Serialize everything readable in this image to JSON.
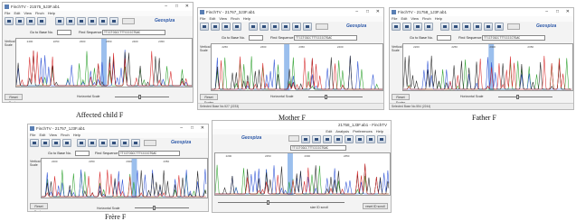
{
  "windows": [
    {
      "key": "w1",
      "title": "FinchTV - 21575_5J3F.ab1",
      "menu": [
        "File",
        "Edit",
        "View",
        "Finch",
        "Help"
      ],
      "goto_label": "Go to Base No.",
      "find_label": "Find Sequence",
      "find_value": "TTCCTCGCCTTTCCCCCTGAC",
      "logo": "Geospiza",
      "vertical_scale": "Vertical Scale",
      "reset_label": "Reset Scales",
      "horizontal_scale": "Horizontal Scale",
      "status": "",
      "ruler": [
        "2400",
        "2250",
        "2300",
        "2350",
        "2400",
        "2450"
      ],
      "caption": "Affected child F"
    },
    {
      "key": "w2",
      "title": "FinchTV - 21767_3J3F.ab1",
      "menu": [
        "File",
        "Edit",
        "View",
        "Finch",
        "Help"
      ],
      "goto_label": "Go to Base No.",
      "find_label": "Find Sequence",
      "find_value": "TTCCTCGCCTTTCCCCCTGAC",
      "logo": "Geospiza",
      "vertical_scale": "Vertical Scale",
      "reset_label": "Reset Scales",
      "horizontal_scale": "Horizontal Scale",
      "status": "Selected Base No.527 (2233)",
      "ruler": [
        "2250",
        "2300",
        "2350",
        "2400"
      ],
      "caption": "Mother F"
    },
    {
      "key": "w3",
      "title": "FinchTV - 21758_1J3F.ab1",
      "menu": [
        "File",
        "Edit",
        "View",
        "Finch",
        "Help"
      ],
      "goto_label": "Go to Base No.",
      "find_label": "Find Sequence",
      "find_value": "TTCCTCGCCTTTCCCCCTGAC",
      "logo": "Geospiza",
      "vertical_scale": "Vertical Scale",
      "reset_label": "Reset Scales",
      "horizontal_scale": "Horizontal Scale",
      "status": "Selected Base No.554 (2244)",
      "ruler": [
        "2200",
        "2250",
        "2300",
        "2350"
      ],
      "caption": "Father F"
    },
    {
      "key": "w4",
      "title": "FinchTV - 21757_1J3F.ab1",
      "menu": [
        "File",
        "Edit",
        "View",
        "Finch",
        "Help"
      ],
      "goto_label": "Go to Base No.",
      "find_label": "Find Sequence",
      "find_value": "TTCCTCGCCTTTCCCCCTGAC",
      "logo": "Geospiza",
      "vertical_scale": "Vertical Scale",
      "reset_label": "Reset Scales",
      "horizontal_scale": "Horizontal Scale",
      "status": "",
      "ruler": [
        "2200",
        "2250",
        "2300",
        "2350"
      ],
      "caption": "Frère F"
    },
    {
      "key": "w5",
      "title": "21758_1J3F.ab1 - FinchTV",
      "menu": [
        "Edit",
        "Analysis",
        "Preferences",
        "Help"
      ],
      "goto_label": "",
      "find_label": "",
      "find_value": "TTCCTCGCCTTTCCCCCTGAC",
      "logo": "Geospiza",
      "vertical_scale": "",
      "reset_label": "reset ID scroll",
      "horizontal_scale": "size ID scroll",
      "status": "",
      "ruler": [
        "2200",
        "2250",
        "2300",
        "2350"
      ],
      "caption": ""
    }
  ],
  "colors": {
    "A": "#2ca02c",
    "C": "#2b50d4",
    "G": "#222222",
    "T": "#d62728",
    "highlight": "#8ab4ea"
  }
}
